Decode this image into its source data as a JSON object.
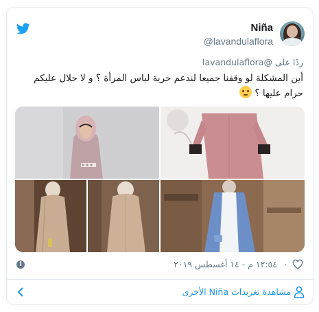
{
  "header": {
    "name": "Niña",
    "handle": "@lavandulaflora",
    "avatar_icon": "profile-photo",
    "brand_icon": "twitter-bird-icon",
    "brand_color": "#1da1f2"
  },
  "tweet": {
    "reply_prefix": "ردًا على",
    "reply_to": "@lavandulaflora",
    "text": "أين المشكلة لو وقفنا جميعا لندعم حرية لباس المرأة ؟ و لا حلال عليكم حرام عليها ؟",
    "emoji": "rolling-eyes-emoji",
    "image_count": 5
  },
  "meta": {
    "timestamp": "١٢:٥٤ م - ١٤ أغسطس ٢٠١٩",
    "like_count": "٠",
    "info_icon": "info-icon",
    "heart_icon": "heart-icon"
  },
  "footer": {
    "more_tweets": "مشاهدة تغريدات Niña الأخرى",
    "link_color": "#1b95e0",
    "chevron_icon": "chevron-left-icon",
    "person_icon": "person-icon"
  }
}
